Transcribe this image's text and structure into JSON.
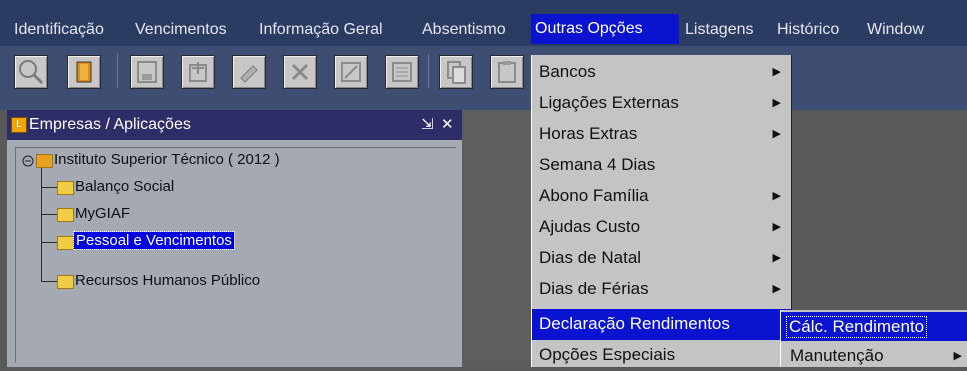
{
  "menubar": {
    "items": [
      {
        "label": "Identificação"
      },
      {
        "label": "Vencimentos"
      },
      {
        "label": "Informação Geral"
      },
      {
        "label": "Absentismo"
      },
      {
        "label": "Outras Opções"
      },
      {
        "label": "Listagens"
      },
      {
        "label": "Histórico"
      },
      {
        "label": "Window"
      }
    ]
  },
  "toolbar": {
    "buttons": [
      {
        "icon": "search-icon"
      },
      {
        "icon": "exit-door-icon"
      },
      {
        "icon": "save-icon"
      },
      {
        "icon": "insert-record-icon"
      },
      {
        "icon": "edit-record-icon"
      },
      {
        "icon": "delete-record-icon"
      },
      {
        "icon": "clear-icon"
      },
      {
        "icon": "list-icon"
      },
      {
        "icon": "copy-icon"
      },
      {
        "icon": "paste-icon"
      },
      {
        "icon": "document-icon"
      }
    ]
  },
  "panel": {
    "title": "Empresas / Aplicações",
    "minimize": "⇲",
    "close": "✕",
    "tree": {
      "root": "Instituto Superior Técnico ( 2012 )",
      "children": [
        {
          "label": "Balanço Social"
        },
        {
          "label": "MyGIAF"
        },
        {
          "label": "Pessoal e Vencimentos"
        },
        {
          "label": "Recursos Humanos Público"
        }
      ]
    }
  },
  "dropdown": {
    "items": [
      {
        "label": "Bancos",
        "submenu": true
      },
      {
        "label": "Ligações Externas",
        "submenu": true
      },
      {
        "label": "Horas Extras",
        "submenu": true
      },
      {
        "label": "Semana 4 Dias",
        "submenu": false
      },
      {
        "label": "Abono Família",
        "submenu": true
      },
      {
        "label": "Ajudas Custo",
        "submenu": true
      },
      {
        "label": "Dias de Natal",
        "submenu": true
      },
      {
        "label": "Dias de Férias",
        "submenu": true
      },
      {
        "label": "Declaração Rendimentos",
        "submenu": true
      },
      {
        "label": "Opções Especiais",
        "submenu": false
      }
    ],
    "arrow": "▶"
  },
  "submenu": {
    "items": [
      {
        "label": "Cálc. Rendimento"
      },
      {
        "label": "Manutenção"
      }
    ]
  },
  "colors": {
    "menubar_bg": "#2b3c63",
    "highlight": "#0a14d0",
    "menu_bg": "#c4c4c4",
    "panel_title_bg": "#2d2d68",
    "tree_bg": "#a4a9b4"
  }
}
